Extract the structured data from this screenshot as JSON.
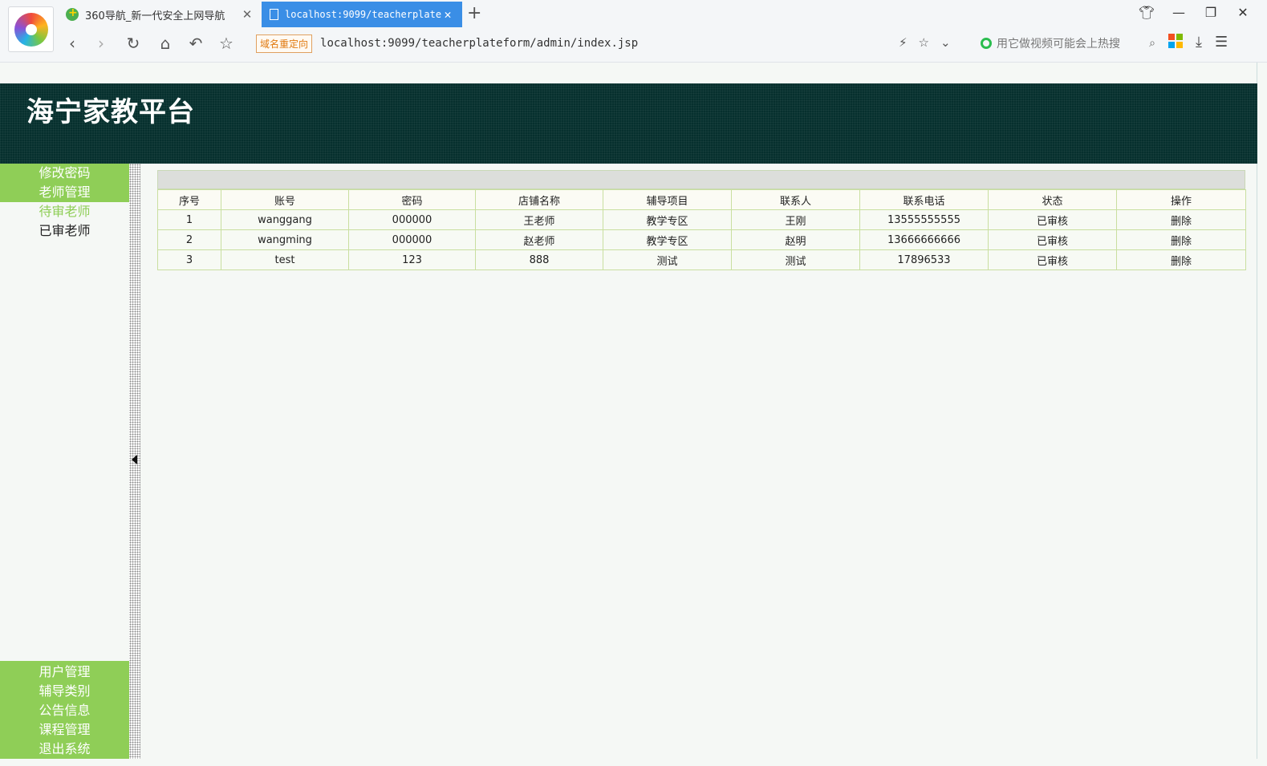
{
  "browser": {
    "tabs": [
      {
        "title": "360导航_新一代安全上网导航"
      },
      {
        "title": "localhost:9099/teacherplatef"
      }
    ],
    "new_tab_label": "+",
    "redirect_badge": "域名重定向",
    "url": "localhost:9099/teacherplateform/admin/index.jsp",
    "search_placeholder": "用它做视频可能会上热搜"
  },
  "site": {
    "title": "海宁家教平台"
  },
  "sidebar": {
    "top_items": [
      {
        "label": "修改密码"
      },
      {
        "label": "老师管理"
      }
    ],
    "sub_items": [
      {
        "label": "待审老师",
        "active": true
      },
      {
        "label": "已审老师",
        "active": false
      }
    ],
    "bottom_items": [
      {
        "label": "用户管理"
      },
      {
        "label": "辅导类别"
      },
      {
        "label": "公告信息"
      },
      {
        "label": "课程管理"
      },
      {
        "label": "退出系统"
      }
    ]
  },
  "table": {
    "headers": [
      "序号",
      "账号",
      "密码",
      "店铺名称",
      "辅导项目",
      "联系人",
      "联系电话",
      "状态",
      "操作"
    ],
    "rows": [
      [
        "1",
        "wanggang",
        "000000",
        "王老师",
        "教学专区",
        "王刚",
        "13555555555",
        "已审核",
        "删除"
      ],
      [
        "2",
        "wangming",
        "000000",
        "赵老师",
        "教学专区",
        "赵明",
        "13666666666",
        "已审核",
        "删除"
      ],
      [
        "3",
        "test",
        "123",
        "888",
        "测试",
        "测试",
        "17896533",
        "已审核",
        "删除"
      ]
    ]
  },
  "colors": {
    "accent_green": "#8fce57",
    "header_bg": "#06302e",
    "active_tab": "#3a8ee6"
  }
}
